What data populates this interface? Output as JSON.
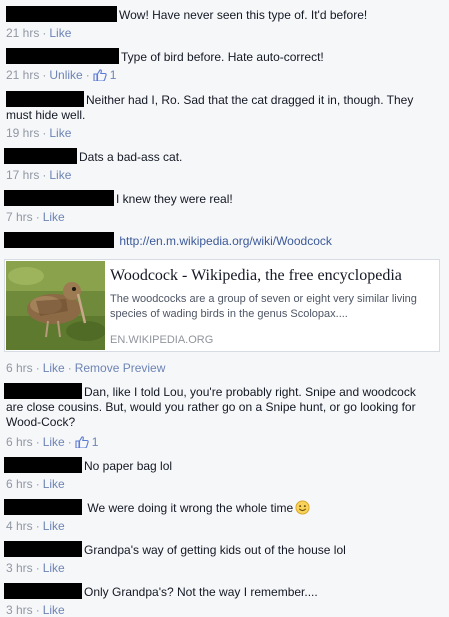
{
  "comments": [
    {
      "text": "Wow! Have never seen this type of. It'd before!",
      "time": "21 hrs",
      "actions": [
        "Like"
      ],
      "likes": ""
    },
    {
      "text": "Type of bird before. Hate auto-correct!",
      "time": "21 hrs",
      "actions": [
        "Unlike"
      ],
      "likes": "1"
    },
    {
      "text": "Neither had I, Ro. Sad that the cat dragged it in, though. They",
      "text2": "must hide well.",
      "time": "19 hrs",
      "actions": [
        "Like"
      ],
      "likes": ""
    },
    {
      "text": "Dats a bad-ass cat.",
      "time": "17 hrs",
      "actions": [
        "Like"
      ],
      "likes": ""
    },
    {
      "text": "I knew they were real!",
      "time": "7 hrs",
      "actions": [
        "Like"
      ],
      "likes": ""
    },
    {
      "text": "http://en.m.wikipedia.org/wiki/Woodcock",
      "time": "6 hrs",
      "actions": [
        "Like",
        "Remove Preview"
      ],
      "likes": ""
    },
    {
      "text": "Dan, like I told Lou, you're probably right. Snipe and woodcock",
      "text2": "are close cousins. But, would you rather go on a Snipe hunt, or go looking for",
      "text3": "Wood-Cock?",
      "time": "6 hrs",
      "actions": [
        "Like"
      ],
      "likes": "1"
    },
    {
      "text": "No paper bag lol",
      "time": "6 hrs",
      "actions": [
        "Like"
      ],
      "likes": ""
    },
    {
      "text": "We were doing it wrong the whole time",
      "time": "4 hrs",
      "actions": [
        "Like"
      ],
      "likes": ""
    },
    {
      "text": "Grandpa's way of getting kids out of the house lol",
      "time": "3 hrs",
      "actions": [
        "Like"
      ],
      "likes": ""
    },
    {
      "text": "Only Grandpa's? Not the way I remember....",
      "time": "3 hrs",
      "actions": [
        "Like"
      ],
      "likes": ""
    }
  ],
  "link_preview": {
    "title": "Woodcock - Wikipedia, the free encyclopedia",
    "description": "The woodcocks are a group of seven or eight very similar living species of wading birds in the genus Scolopax....",
    "domain": "EN.WIKIPEDIA.ORG",
    "image": "woodcock-bird-photo"
  },
  "icons": {
    "like": "thumbs-up-icon",
    "emoji": "smiley-face-icon"
  },
  "colors": {
    "link": "#3b5998",
    "meta": "#9197a3",
    "action": "#6d84b4",
    "redaction": "#000000",
    "background": "#f6f7f9"
  }
}
